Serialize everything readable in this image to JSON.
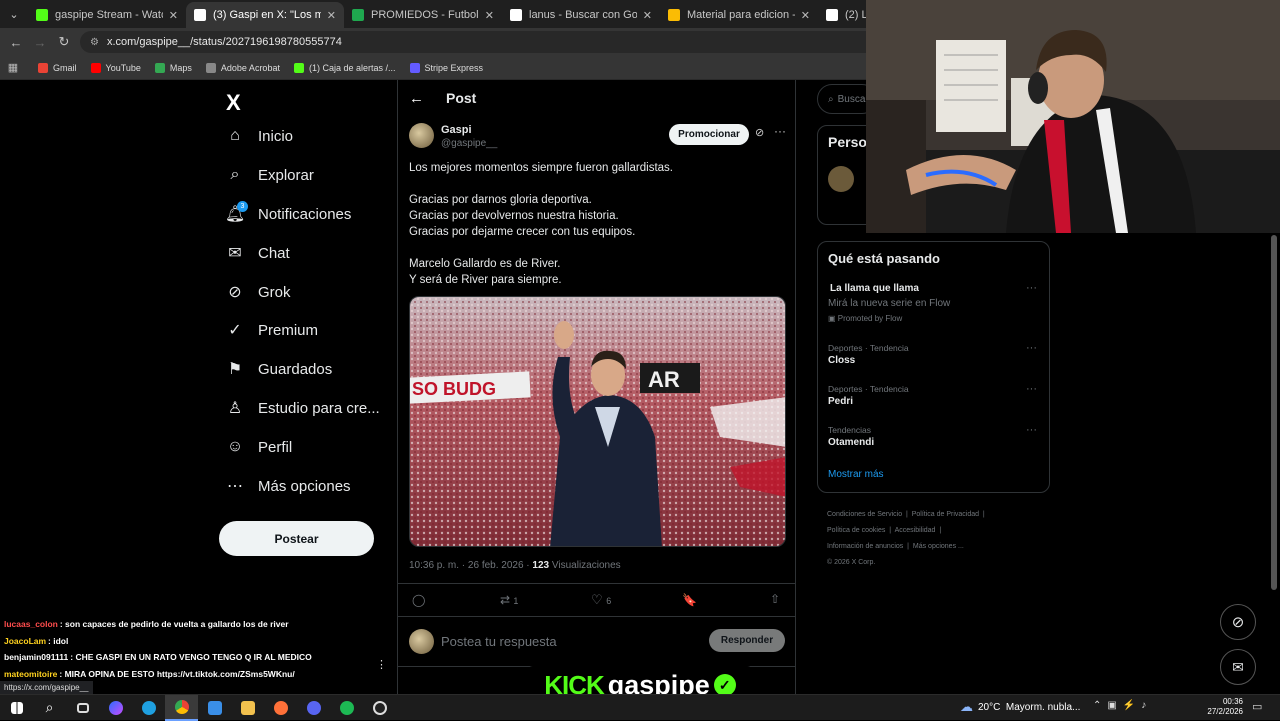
{
  "browser": {
    "tabs": [
      {
        "title": "gaspipe Stream - Watch Live on",
        "favicon": "kick-icon",
        "color": "#53fc18",
        "active": false
      },
      {
        "title": "(3) Gaspi en X: \"Los mejores mo",
        "favicon": "x-icon",
        "color": "#ffffff",
        "active": true
      },
      {
        "title": "PROMIEDOS - Futbol Argentino",
        "favicon": "promiedos-icon",
        "color": "#1fa84f",
        "active": false
      },
      {
        "title": "lanus - Buscar con Google",
        "favicon": "google-icon",
        "color": "#ffffff",
        "active": false
      },
      {
        "title": "Material para edicion - Google",
        "favicon": "drive-icon",
        "color": "#fbbc04",
        "active": false
      },
      {
        "title": "(2) LAN",
        "favicon": "x-icon",
        "color": "#ffffff",
        "active": false
      }
    ],
    "url": "x.com/gaspipe__/status/2027196198780555774",
    "bookmarks": [
      {
        "label": "Gmail",
        "color": "#ea4335"
      },
      {
        "label": "YouTube",
        "color": "#ff0000"
      },
      {
        "label": "Maps",
        "color": "#34a853"
      },
      {
        "label": "Adobe Acrobat",
        "color": "#888888"
      },
      {
        "label": "(1) Caja de alertas /...",
        "color": "#53fc18"
      },
      {
        "label": "Stripe Express",
        "color": "#635bff"
      }
    ]
  },
  "sidebar": {
    "logo": "X",
    "items": [
      {
        "label": "Inicio",
        "icon": "home-icon"
      },
      {
        "label": "Explorar",
        "icon": "search-icon"
      },
      {
        "label": "Notificaciones",
        "icon": "bell-icon",
        "badge": "3"
      },
      {
        "label": "Chat",
        "icon": "mail-icon"
      },
      {
        "label": "Grok",
        "icon": "grok-icon"
      },
      {
        "label": "Premium",
        "icon": "verified-icon"
      },
      {
        "label": "Guardados",
        "icon": "bookmark-icon"
      },
      {
        "label": "Estudio para cre...",
        "icon": "studio-icon"
      },
      {
        "label": "Perfil",
        "icon": "person-icon"
      },
      {
        "label": "Más opciones",
        "icon": "more-circle-icon"
      }
    ],
    "post_button": "Postear"
  },
  "post": {
    "header_title": "Post",
    "author_name": "Gaspi",
    "author_handle": "@gaspipe__",
    "promote_label": "Promocionar",
    "lines": [
      "Los mejores momentos siempre fueron gallardistas.",
      "Gracias por darnos gloria deportiva.",
      "Gracias por devolvernos nuestra historia.",
      "Gracias por dejarme crecer con tus equipos.",
      "Marcelo Gallardo es de River.",
      "Y será de River para siempre."
    ],
    "image_banner_text": "SO BUDG",
    "image_banner_text2": "AR",
    "timestamp": "10:36 p. m. · 26 feb. 2026 ·",
    "views_count": "123",
    "views_label": "Visualizaciones",
    "retweets": "1",
    "likes": "6",
    "reply_placeholder": "Postea tu respuesta",
    "reply_button": "Responder"
  },
  "right": {
    "search_placeholder": "Busca",
    "persons_title": "Perso",
    "trends_title": "Qué está pasando",
    "trends": [
      {
        "context": "",
        "title": "La llama que llama",
        "sub": "Mirá la nueva serie en Flow",
        "promo": "Promoted by Flow"
      },
      {
        "context": "Deportes · Tendencia",
        "title": "Closs"
      },
      {
        "context": "Deportes · Tendencia",
        "title": "Pedri"
      },
      {
        "context": "Tendencias",
        "title": "Otamendi"
      }
    ],
    "show_more": "Mostrar más",
    "footer_links": [
      "Condiciones de Servicio",
      "Política de Privacidad",
      "Política de cookies",
      "Accesibilidad",
      "Información de anuncios",
      "Más opciones ...",
      "© 2026 X Corp."
    ]
  },
  "chat": [
    {
      "user": "lucaas_colon",
      "color": "#ff4d4d",
      "msg": ": son capaces de pedirlo de vuelta a gallardo los de river"
    },
    {
      "user": "JoacoLam",
      "color": "#ffd21f",
      "msg": ": idol"
    },
    {
      "user": "benjamin091111",
      "color": "#ffffff",
      "msg": ": CHE GASPI EN UN RATO VENGO TENGO Q IR AL MEDICO"
    },
    {
      "user": "mateomitoire",
      "color": "#ffd21f",
      "msg": ": MIRA OPINA DE ESTO https://vt.tiktok.com/ZSms5WKnu/"
    }
  ],
  "status_url": "https://x.com/gaspipe__",
  "overlay_brand": {
    "kick": "KICK",
    "name": "gaspipe"
  },
  "taskbar": {
    "weather_temp": "20°C",
    "weather_desc": "Mayorm. nubla...",
    "time": "00:36",
    "date": "27/2/2026"
  }
}
